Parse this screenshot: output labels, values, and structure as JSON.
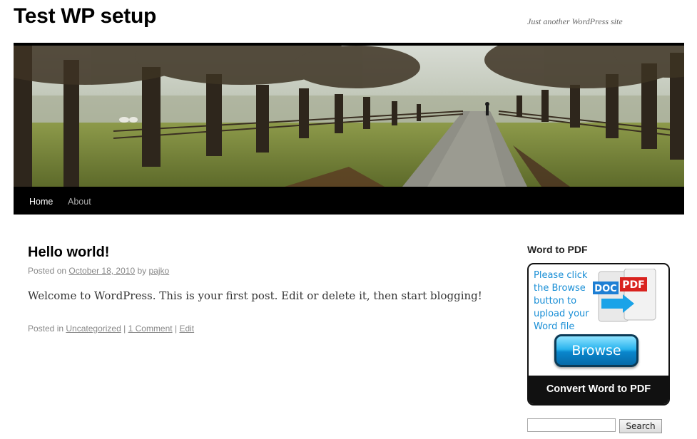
{
  "site": {
    "title": "Test WP setup",
    "description": "Just another WordPress site"
  },
  "nav": {
    "items": [
      {
        "label": "Home"
      },
      {
        "label": "About"
      }
    ]
  },
  "post": {
    "title": "Hello world!",
    "posted_on_label": "Posted on",
    "date": "October 18, 2010",
    "by_label": "by",
    "author": "pajko",
    "body": "Welcome to WordPress. This is your first post. Edit or delete it, then start blogging!",
    "posted_in_label": "Posted in",
    "category": "Uncategorized",
    "sep": "|",
    "comments": "1 Comment",
    "edit": "Edit"
  },
  "sidebar": {
    "widget_title": "Word to PDF",
    "ad": {
      "text": "Please click the Browse button to upload your Word file",
      "doc_label": "DOC",
      "pdf_label": "PDF",
      "browse_label": "Browse",
      "bottom_label": "Convert Word to PDF"
    },
    "search": {
      "value": "",
      "button_label": "Search"
    }
  },
  "colors": {
    "nav_bg": "#000000",
    "ad_text": "#1a8fd6",
    "pdf_red": "#d9231f",
    "doc_blue": "#1e7fd4"
  }
}
